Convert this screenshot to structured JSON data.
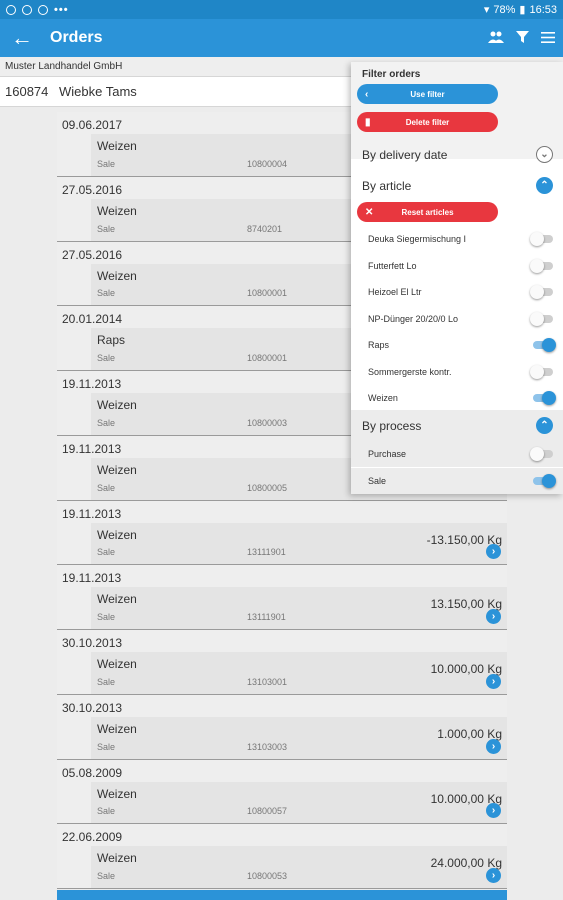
{
  "status_bar": {
    "left_icons": [
      "image-icon",
      "account-icon",
      "android-icon"
    ],
    "more": "•••",
    "signal": "📶",
    "battery": "78%",
    "time": "16:53"
  },
  "app_bar": {
    "back_icon": "arrow-left-icon",
    "title": "Orders",
    "actions": [
      "people-icon",
      "filter-icon",
      "menu-icon"
    ]
  },
  "company": "Muster Landhandel GmbH",
  "customer": {
    "number": "160874",
    "name": "Wiebke Tams"
  },
  "orders": [
    {
      "date": "09.06.2017",
      "article": "Weizen",
      "process": "Sale",
      "number": "10800004",
      "quantity": ""
    },
    {
      "date": "27.05.2016",
      "article": "Weizen",
      "process": "Sale",
      "number": "8740201",
      "quantity": ""
    },
    {
      "date": "27.05.2016",
      "article": "Weizen",
      "process": "Sale",
      "number": "10800001",
      "quantity": ""
    },
    {
      "date": "20.01.2014",
      "article": "Raps",
      "process": "Sale",
      "number": "10800001",
      "quantity": ""
    },
    {
      "date": "19.11.2013",
      "article": "Weizen",
      "process": "Sale",
      "number": "10800003",
      "quantity": ""
    },
    {
      "date": "19.11.2013",
      "article": "Weizen",
      "process": "Sale",
      "number": "10800005",
      "quantity": ""
    },
    {
      "date": "19.11.2013",
      "article": "Weizen",
      "process": "Sale",
      "number": "13111901",
      "quantity": "-13.150,00 Kg"
    },
    {
      "date": "19.11.2013",
      "article": "Weizen",
      "process": "Sale",
      "number": "13111901",
      "quantity": "13.150,00 Kg"
    },
    {
      "date": "30.10.2013",
      "article": "Weizen",
      "process": "Sale",
      "number": "13103001",
      "quantity": "10.000,00 Kg"
    },
    {
      "date": "30.10.2013",
      "article": "Weizen",
      "process": "Sale",
      "number": "13103003",
      "quantity": "1.000,00 Kg"
    },
    {
      "date": "05.08.2009",
      "article": "Weizen",
      "process": "Sale",
      "number": "10800057",
      "quantity": "10.000,00 Kg"
    },
    {
      "date": "22.06.2009",
      "article": "Weizen",
      "process": "Sale",
      "number": "10800053",
      "quantity": "24.000,00 Kg"
    }
  ],
  "filter": {
    "title": "Filter orders",
    "use_filter": "Use filter",
    "delete_filter": "Delete filter",
    "by_delivery_date": "By delivery date",
    "by_article": "By article",
    "reset_articles": "Reset articles",
    "articles": [
      {
        "label": "Deuka Siegermischung I",
        "on": false
      },
      {
        "label": "Futterfett Lo",
        "on": false
      },
      {
        "label": "Heizoel El Ltr",
        "on": false
      },
      {
        "label": "NP-Dünger 20/20/0 Lo",
        "on": false
      },
      {
        "label": "Raps",
        "on": true
      },
      {
        "label": "Sommergerste kontr.",
        "on": false
      },
      {
        "label": "Weizen",
        "on": true
      }
    ],
    "by_process": "By process",
    "processes": [
      {
        "label": "Purchase",
        "on": false
      },
      {
        "label": "Sale",
        "on": true
      }
    ]
  },
  "colors": {
    "primary": "#2b93d8",
    "danger": "#e8373f"
  }
}
